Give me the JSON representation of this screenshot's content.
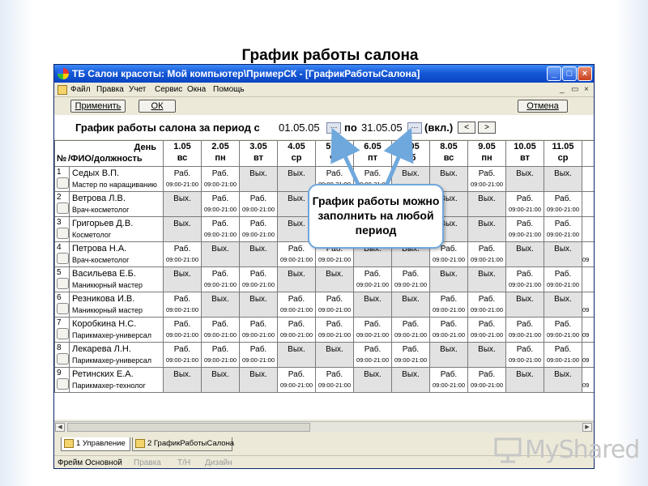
{
  "slide_title": "График работы салона",
  "window": {
    "title": "ТБ Салон красоты: Мой компьютер\\ПримерСК - [ГрафикРаботыСалона]",
    "minimize": "_",
    "maximize": "□",
    "close": "×"
  },
  "menu": [
    "Файл",
    "Правка",
    "Учет",
    "Сервис",
    "Окна",
    "Помощь"
  ],
  "mdi_buttons": [
    "_",
    "▭",
    "×"
  ],
  "actions": {
    "apply": "Применить",
    "ok": "ОК",
    "cancel": "Отмена"
  },
  "period": {
    "label": "График работы салона за период с",
    "from": "01.05.05",
    "to_label": "по",
    "to": "31.05.05",
    "incl": "(вкл.)",
    "dots": "···",
    "prev": "<",
    "next": ">"
  },
  "grid": {
    "header_day": "День",
    "header_num": "№",
    "header_name": "/ФИО/должность",
    "days": [
      {
        "date": "1.05",
        "dow": "вс"
      },
      {
        "date": "2.05",
        "dow": "пн"
      },
      {
        "date": "3.05",
        "dow": "вт"
      },
      {
        "date": "4.05",
        "dow": "ср"
      },
      {
        "date": "5.05",
        "dow": "чт"
      },
      {
        "date": "6.05",
        "dow": "пт"
      },
      {
        "date": "7.05",
        "dow": "сб"
      },
      {
        "date": "8.05",
        "dow": "вс"
      },
      {
        "date": "9.05",
        "dow": "пн"
      },
      {
        "date": "10.05",
        "dow": "вт"
      },
      {
        "date": "11.05",
        "dow": "ср"
      }
    ],
    "work_label": "Раб.",
    "off_label": "Вых.",
    "hours": "09:00-21:00",
    "employees": [
      {
        "num": "1",
        "name": "Седых В.П.",
        "position": "Мастер по наращиванию",
        "schedule": [
          "W",
          "W",
          "O",
          "O",
          "W",
          "W",
          "O",
          "O",
          "W",
          "O",
          "O"
        ]
      },
      {
        "num": "2",
        "name": "Ветрова Л.В.",
        "position": "Врач-косметолог",
        "schedule": [
          "O",
          "W",
          "W",
          "O",
          "O",
          "O",
          "O",
          "O",
          "O",
          "W",
          "W"
        ]
      },
      {
        "num": "3",
        "name": "Григорьев Д.В.",
        "position": "Косметолог",
        "schedule": [
          "O",
          "W",
          "W",
          "O",
          "O",
          "O",
          "O",
          "O",
          "O",
          "W",
          "W"
        ]
      },
      {
        "num": "4",
        "name": "Петрова Н.А.",
        "position": "Врач-косметолог",
        "schedule": [
          "W",
          "O",
          "O",
          "W",
          "W",
          "O",
          "O",
          "W",
          "W",
          "O",
          "O"
        ]
      },
      {
        "num": "5",
        "name": "Васильева Е.Б.",
        "position": "Маникюрный мастер",
        "schedule": [
          "O",
          "W",
          "W",
          "O",
          "O",
          "W",
          "W",
          "O",
          "O",
          "W",
          "W"
        ]
      },
      {
        "num": "6",
        "name": "Резникова И.В.",
        "position": "Маникюрный мастер",
        "schedule": [
          "W",
          "O",
          "O",
          "W",
          "W",
          "O",
          "O",
          "W",
          "W",
          "O",
          "O"
        ]
      },
      {
        "num": "7",
        "name": "Коробкина Н.С.",
        "position": "Парикмахер-универсал",
        "schedule": [
          "W",
          "W",
          "W",
          "W",
          "W",
          "W",
          "W",
          "W",
          "W",
          "W",
          "W"
        ]
      },
      {
        "num": "8",
        "name": "Лекарева Л.Н.",
        "position": "Парикмахер-универсал",
        "schedule": [
          "W",
          "W",
          "W",
          "O",
          "O",
          "W",
          "W",
          "O",
          "O",
          "W",
          "W"
        ]
      },
      {
        "num": "9",
        "name": "Ретинских Е.А.",
        "position": "Парикмахер-технолог",
        "schedule": [
          "O",
          "O",
          "O",
          "W",
          "W",
          "O",
          "O",
          "W",
          "W",
          "O",
          "O"
        ]
      }
    ],
    "partial_col_text": "09"
  },
  "tabs": [
    "1 Управление",
    "2 ГрафикРаботыСалона"
  ],
  "statusbar": {
    "frame": "Фрейм",
    "main": "Основной",
    "edit": "Правка",
    "tn": "Т/Н",
    "design": "Дизайн"
  },
  "callout": "График работы можно заполнить на любой период",
  "logo_text": "MyShared",
  "colors": {
    "titlebar": "#1659d8",
    "off_cell": "#e2e2e2",
    "callout_border": "#6fa8dc",
    "window_face": "#ece9d8"
  }
}
